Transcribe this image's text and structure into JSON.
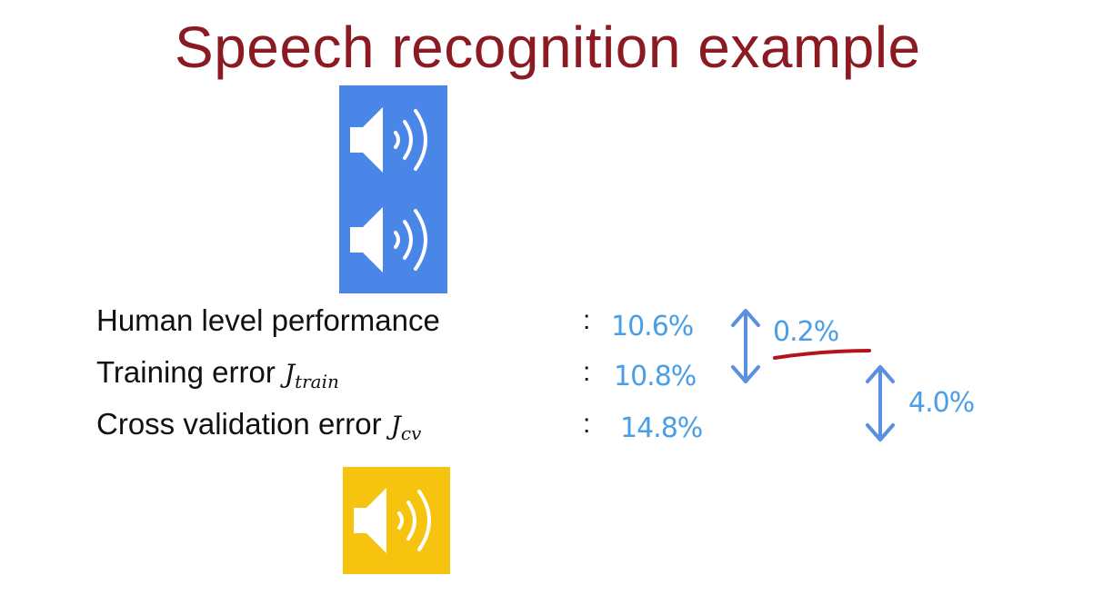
{
  "slide": {
    "title": "Speech recognition example"
  },
  "rows": [
    {
      "label": "Human level performance",
      "math": "",
      "math_sub": "",
      "colon": ":",
      "value": "10.6%"
    },
    {
      "label": "Training error",
      "math": "J",
      "math_sub": "train",
      "colon": ":",
      "value": "10.8%"
    },
    {
      "label": "Cross validation error",
      "math": "J",
      "math_sub": "cv",
      "colon": ":",
      "value": "14.8%"
    }
  ],
  "annotations": {
    "gap_human_train": "0.2%",
    "gap_train_cv": "4.0%"
  },
  "colors": {
    "title": "#8b1a22",
    "audio_block_top": "#4a86e8",
    "audio_block_bottom": "#f6c40e",
    "handwriting": "#4a9ee6",
    "arrow": "#5b8fe0",
    "underline": "#b5121b"
  },
  "icons": {
    "audio_top_1": "speaker-icon",
    "audio_top_2": "speaker-icon",
    "audio_bottom": "speaker-icon"
  }
}
